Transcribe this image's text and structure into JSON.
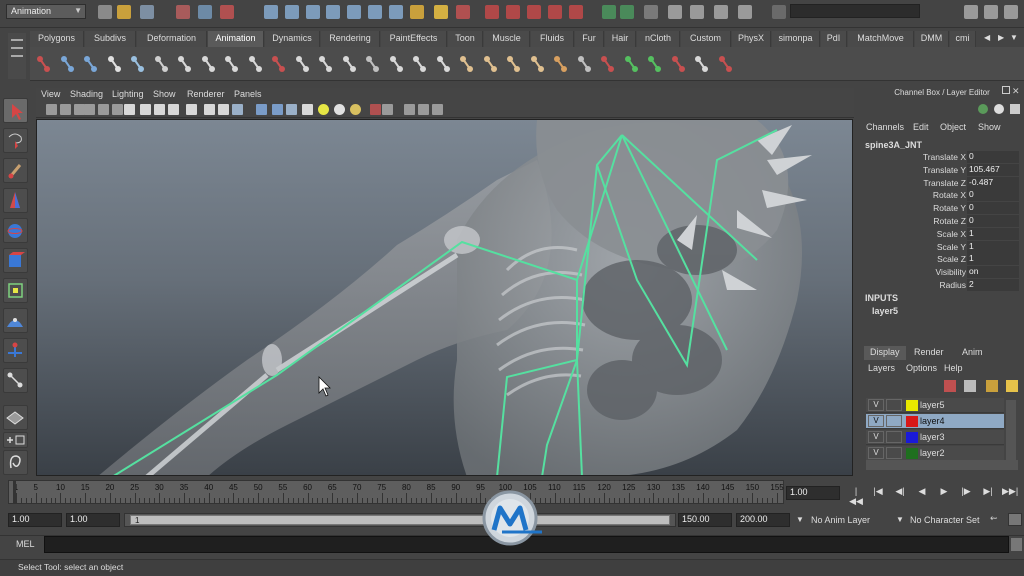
{
  "status_line": {
    "mode_selector": "Animation"
  },
  "shelf": {
    "tabs": [
      "Polygons",
      "Subdivs",
      "Deformation",
      "Animation",
      "Dynamics",
      "Rendering",
      "PaintEffects",
      "Toon",
      "Muscle",
      "Fluids",
      "Fur",
      "Hair",
      "nCloth",
      "Custom",
      "PhysX",
      "simonpa",
      "PdI",
      "MatchMove",
      "DMM",
      "cmi"
    ],
    "active_tab": "Animation"
  },
  "panel": {
    "menus": [
      "View",
      "Shading",
      "Lighting",
      "Show",
      "Renderer",
      "Panels"
    ]
  },
  "channel_box": {
    "title": "Channel Box / Layer Editor",
    "menus": [
      "Channels",
      "Edit",
      "Object",
      "Show"
    ],
    "object_name": "spine3A_JNT",
    "attributes": [
      {
        "label": "Translate X",
        "value": "0"
      },
      {
        "label": "Translate Y",
        "value": "105.467"
      },
      {
        "label": "Translate Z",
        "value": "-0.487"
      },
      {
        "label": "Rotate X",
        "value": "0"
      },
      {
        "label": "Rotate Y",
        "value": "0"
      },
      {
        "label": "Rotate Z",
        "value": "0"
      },
      {
        "label": "Scale X",
        "value": "1"
      },
      {
        "label": "Scale Y",
        "value": "1"
      },
      {
        "label": "Scale Z",
        "value": "1"
      },
      {
        "label": "Visibility",
        "value": "on"
      },
      {
        "label": "Radius",
        "value": "2"
      }
    ],
    "inputs_label": "INPUTS",
    "input_node": "layer5"
  },
  "layer_editor": {
    "tabs": [
      "Display",
      "Render",
      "Anim"
    ],
    "active_tab": "Display",
    "menus": [
      "Layers",
      "Options",
      "Help"
    ],
    "layers": [
      {
        "vis": "V",
        "name": "layer5",
        "color": "#e8e800",
        "selected": false
      },
      {
        "vis": "V",
        "name": "layer4",
        "color": "#d81818",
        "selected": true
      },
      {
        "vis": "V",
        "name": "layer3",
        "color": "#1a1ad8",
        "selected": false
      },
      {
        "vis": "V",
        "name": "layer2",
        "color": "#1f6f1f",
        "selected": false
      }
    ]
  },
  "time_slider": {
    "ticks": [
      "1",
      "5",
      "10",
      "15",
      "20",
      "25",
      "30",
      "35",
      "40",
      "45",
      "50",
      "55",
      "60",
      "65",
      "70",
      "75",
      "80",
      "85",
      "90",
      "95",
      "100",
      "105",
      "110",
      "115",
      "120",
      "125",
      "130",
      "135",
      "140",
      "145",
      "150",
      "155"
    ],
    "current_frame": "1.00"
  },
  "range_slider": {
    "start_time": "1.00",
    "playback_start": "1.00",
    "handle_label": "1",
    "playback_end": "150.00",
    "end_time": "200.00",
    "anim_layer": "No Anim Layer",
    "character_set": "No Character Set"
  },
  "command_line": {
    "label": "MEL"
  },
  "help_line": {
    "text": "Select Tool: select an object"
  },
  "colors": {
    "joint_color": "#55e0a0",
    "ui_background": "#444444",
    "selected_layer": "#8fa9c4"
  }
}
